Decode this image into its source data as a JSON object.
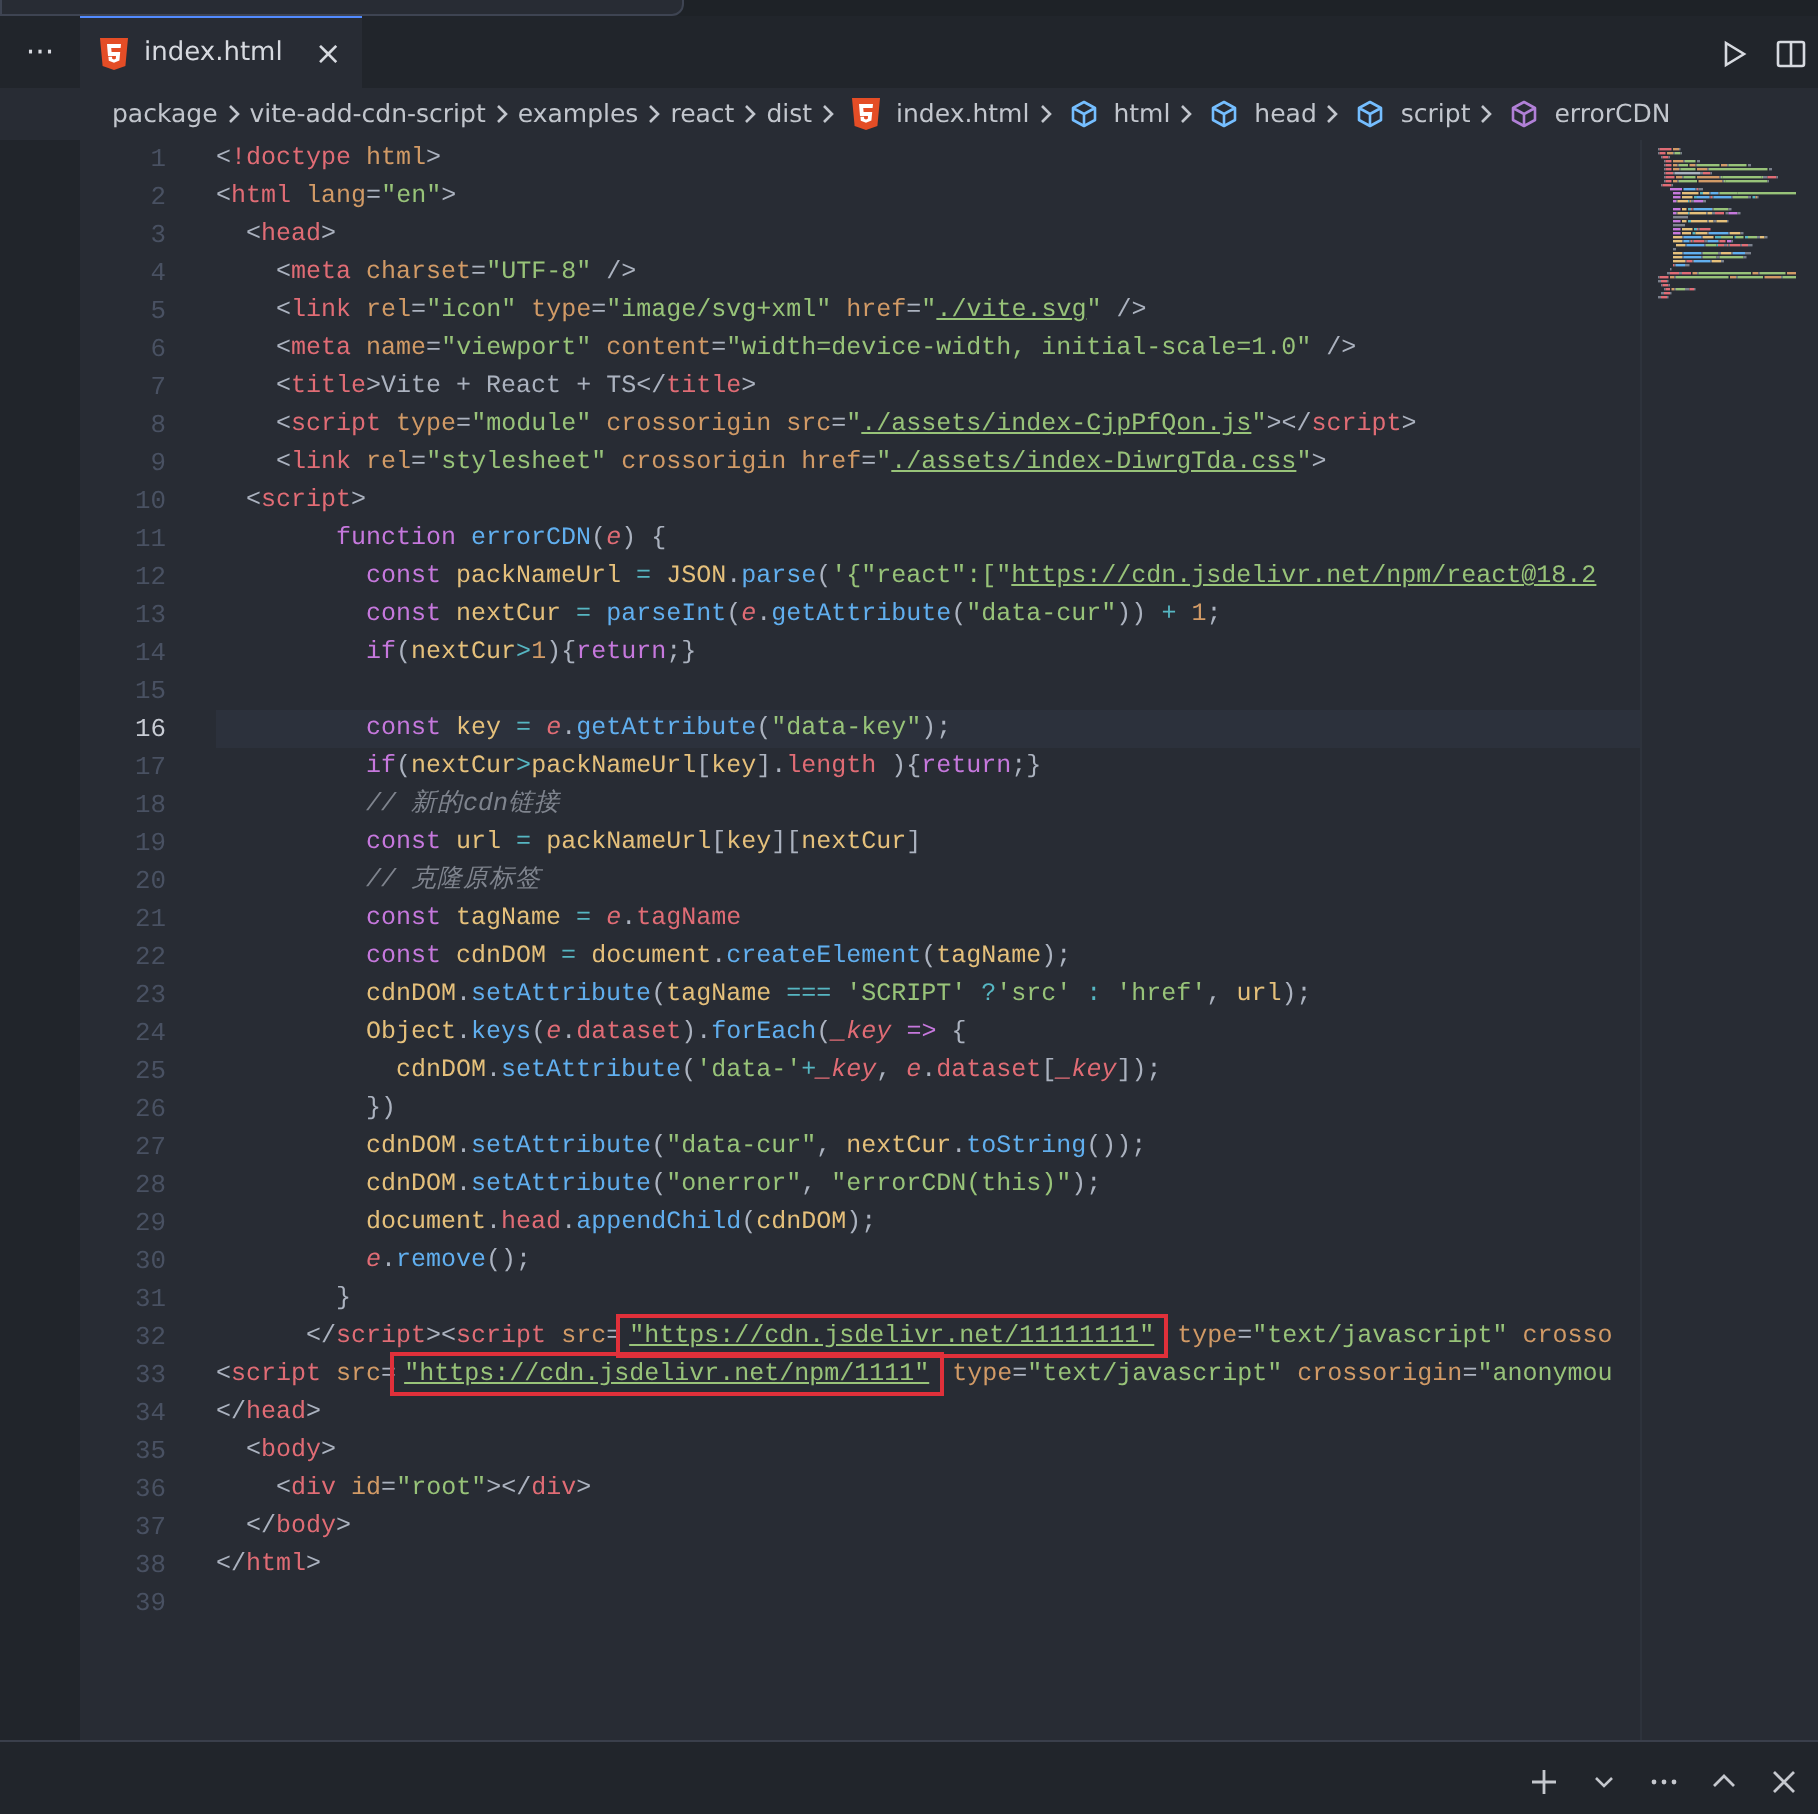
{
  "tab_bar": {
    "overflow": "···",
    "tabs": [
      {
        "label": "index.html",
        "close": "×",
        "selected": true
      }
    ]
  },
  "breadcrumb": [
    {
      "label": "package",
      "kind": "folder"
    },
    {
      "label": "vite-add-cdn-script",
      "kind": "folder"
    },
    {
      "label": "examples",
      "kind": "folder"
    },
    {
      "label": "react",
      "kind": "folder"
    },
    {
      "label": "dist",
      "kind": "folder"
    },
    {
      "label": "index.html",
      "kind": "file"
    },
    {
      "label": "html",
      "kind": "element"
    },
    {
      "label": "head",
      "kind": "element"
    },
    {
      "label": "script",
      "kind": "element"
    },
    {
      "label": "errorCDN",
      "kind": "function"
    }
  ],
  "lines": [
    {
      "number": "1",
      "current": false,
      "tokens": [
        {
          "text": "<",
          "kind": "p"
        },
        {
          "text": "!doctype",
          "kind": "tag"
        },
        {
          "text": " html",
          "kind": "attr"
        },
        {
          "text": ">",
          "kind": "p"
        }
      ]
    },
    {
      "number": "2",
      "current": false,
      "tokens": [
        {
          "text": "<",
          "kind": "p"
        },
        {
          "text": "html",
          "kind": "tag"
        },
        {
          "text": " lang",
          "kind": "attr"
        },
        {
          "text": "=",
          "kind": "p"
        },
        {
          "text": "\"en\"",
          "kind": "str"
        },
        {
          "text": ">",
          "kind": "p"
        }
      ]
    },
    {
      "number": "3",
      "current": false,
      "tokens": [
        {
          "text": "  <",
          "kind": "p"
        },
        {
          "text": "head",
          "kind": "tag"
        },
        {
          "text": ">",
          "kind": "p"
        }
      ]
    },
    {
      "number": "4",
      "current": false,
      "tokens": [
        {
          "text": "    <",
          "kind": "p"
        },
        {
          "text": "meta",
          "kind": "tag"
        },
        {
          "text": " charset",
          "kind": "attr"
        },
        {
          "text": "=",
          "kind": "p"
        },
        {
          "text": "\"UTF-8\"",
          "kind": "str"
        },
        {
          "text": " />",
          "kind": "p"
        }
      ]
    },
    {
      "number": "5",
      "current": false,
      "tokens": [
        {
          "text": "    <",
          "kind": "p"
        },
        {
          "text": "link",
          "kind": "tag"
        },
        {
          "text": " rel",
          "kind": "attr"
        },
        {
          "text": "=",
          "kind": "p"
        },
        {
          "text": "\"icon\"",
          "kind": "str"
        },
        {
          "text": " type",
          "kind": "attr"
        },
        {
          "text": "=",
          "kind": "p"
        },
        {
          "text": "\"image/svg+xml\"",
          "kind": "str"
        },
        {
          "text": " href",
          "kind": "attr"
        },
        {
          "text": "=",
          "kind": "p"
        },
        {
          "text": "\"",
          "kind": "str"
        },
        {
          "text": "./vite.svg",
          "kind": "url"
        },
        {
          "text": "\"",
          "kind": "str"
        },
        {
          "text": " />",
          "kind": "p"
        }
      ]
    },
    {
      "number": "6",
      "current": false,
      "tokens": [
        {
          "text": "    <",
          "kind": "p"
        },
        {
          "text": "meta",
          "kind": "tag"
        },
        {
          "text": " name",
          "kind": "attr"
        },
        {
          "text": "=",
          "kind": "p"
        },
        {
          "text": "\"viewport\"",
          "kind": "str"
        },
        {
          "text": " content",
          "kind": "attr"
        },
        {
          "text": "=",
          "kind": "p"
        },
        {
          "text": "\"width=device-width, initial-scale=1.0\"",
          "kind": "str"
        },
        {
          "text": " />",
          "kind": "p"
        }
      ]
    },
    {
      "number": "7",
      "current": false,
      "tokens": [
        {
          "text": "    <",
          "kind": "p"
        },
        {
          "text": "title",
          "kind": "tag"
        },
        {
          "text": ">",
          "kind": "p"
        },
        {
          "text": "Vite + React + TS",
          "kind": "plain"
        },
        {
          "text": "</",
          "kind": "p"
        },
        {
          "text": "title",
          "kind": "tag"
        },
        {
          "text": ">",
          "kind": "p"
        }
      ]
    },
    {
      "number": "8",
      "current": false,
      "tokens": [
        {
          "text": "    <",
          "kind": "p"
        },
        {
          "text": "script",
          "kind": "tag"
        },
        {
          "text": " type",
          "kind": "attr"
        },
        {
          "text": "=",
          "kind": "p"
        },
        {
          "text": "\"module\"",
          "kind": "str"
        },
        {
          "text": " crossorigin src",
          "kind": "attr"
        },
        {
          "text": "=",
          "kind": "p"
        },
        {
          "text": "\"",
          "kind": "str"
        },
        {
          "text": "./assets/index-CjpPfQon.js",
          "kind": "url"
        },
        {
          "text": "\"",
          "kind": "str"
        },
        {
          "text": "></",
          "kind": "p"
        },
        {
          "text": "script",
          "kind": "tag"
        },
        {
          "text": ">",
          "kind": "p"
        }
      ]
    },
    {
      "number": "9",
      "current": false,
      "tokens": [
        {
          "text": "    <",
          "kind": "p"
        },
        {
          "text": "link",
          "kind": "tag"
        },
        {
          "text": " rel",
          "kind": "attr"
        },
        {
          "text": "=",
          "kind": "p"
        },
        {
          "text": "\"stylesheet\"",
          "kind": "str"
        },
        {
          "text": " crossorigin href",
          "kind": "attr"
        },
        {
          "text": "=",
          "kind": "p"
        },
        {
          "text": "\"",
          "kind": "str"
        },
        {
          "text": "./assets/index-DiwrgTda.css",
          "kind": "url"
        },
        {
          "text": "\"",
          "kind": "str"
        },
        {
          "text": ">",
          "kind": "p"
        }
      ]
    },
    {
      "number": "10",
      "current": false,
      "tokens": [
        {
          "text": "  <",
          "kind": "p"
        },
        {
          "text": "script",
          "kind": "tag"
        },
        {
          "text": ">",
          "kind": "p"
        }
      ]
    },
    {
      "number": "11",
      "current": false,
      "tokens": [
        {
          "text": "        function",
          "kind": "kw"
        },
        {
          "text": " errorCDN",
          "kind": "fn"
        },
        {
          "text": "(",
          "kind": "p"
        },
        {
          "text": "e",
          "kind": "prm"
        },
        {
          "text": ") {",
          "kind": "p"
        }
      ]
    },
    {
      "number": "12",
      "current": false,
      "tokens": [
        {
          "text": "          const",
          "kind": "kw"
        },
        {
          "text": " packNameUrl",
          "kind": "var"
        },
        {
          "text": " = ",
          "kind": "op"
        },
        {
          "text": "JSON",
          "kind": "var"
        },
        {
          "text": ".",
          "kind": "p"
        },
        {
          "text": "parse",
          "kind": "fn"
        },
        {
          "text": "(",
          "kind": "p"
        },
        {
          "text": "'{\"react\":[\"",
          "kind": "str"
        },
        {
          "text": "https://cdn.jsdelivr.net/npm/react@18.2",
          "kind": "url"
        }
      ]
    },
    {
      "number": "13",
      "current": false,
      "tokens": [
        {
          "text": "          const",
          "kind": "kw"
        },
        {
          "text": " nextCur",
          "kind": "var"
        },
        {
          "text": " = ",
          "kind": "op"
        },
        {
          "text": "parseInt",
          "kind": "fn"
        },
        {
          "text": "(",
          "kind": "p"
        },
        {
          "text": "e",
          "kind": "prm"
        },
        {
          "text": ".",
          "kind": "p"
        },
        {
          "text": "getAttribute",
          "kind": "fn"
        },
        {
          "text": "(",
          "kind": "p"
        },
        {
          "text": "\"data-cur\"",
          "kind": "str"
        },
        {
          "text": "))",
          "kind": "p"
        },
        {
          "text": " + ",
          "kind": "op"
        },
        {
          "text": "1",
          "kind": "num"
        },
        {
          "text": ";",
          "kind": "p"
        }
      ]
    },
    {
      "number": "14",
      "current": false,
      "tokens": [
        {
          "text": "          if",
          "kind": "kw"
        },
        {
          "text": "(",
          "kind": "p"
        },
        {
          "text": "nextCur",
          "kind": "var"
        },
        {
          "text": ">",
          "kind": "op"
        },
        {
          "text": "1",
          "kind": "num"
        },
        {
          "text": "){",
          "kind": "p"
        },
        {
          "text": "return",
          "kind": "kw"
        },
        {
          "text": ";}",
          "kind": "p"
        }
      ]
    },
    {
      "number": "15",
      "current": false
    },
    {
      "number": "16",
      "current": true,
      "tokens": [
        {
          "text": "          const",
          "kind": "kw"
        },
        {
          "text": " key",
          "kind": "var"
        },
        {
          "text": " = ",
          "kind": "op"
        },
        {
          "text": "e",
          "kind": "prm"
        },
        {
          "text": ".",
          "kind": "p"
        },
        {
          "text": "getAttribute",
          "kind": "fn"
        },
        {
          "text": "(",
          "kind": "p"
        },
        {
          "text": "\"data-key\"",
          "kind": "str"
        },
        {
          "text": ");",
          "kind": "p"
        }
      ]
    },
    {
      "number": "17",
      "current": false,
      "tokens": [
        {
          "text": "          if",
          "kind": "kw"
        },
        {
          "text": "(",
          "kind": "p"
        },
        {
          "text": "nextCur",
          "kind": "var"
        },
        {
          "text": ">",
          "kind": "op"
        },
        {
          "text": "packNameUrl",
          "kind": "var"
        },
        {
          "text": "[",
          "kind": "p"
        },
        {
          "text": "key",
          "kind": "var"
        },
        {
          "text": "].",
          "kind": "p"
        },
        {
          "text": "length",
          "kind": "prop"
        },
        {
          "text": " ){",
          "kind": "p"
        },
        {
          "text": "return",
          "kind": "kw"
        },
        {
          "text": ";}",
          "kind": "p"
        }
      ]
    },
    {
      "number": "18",
      "current": false,
      "tokens": [
        {
          "text": "          // 新的cdn链接",
          "kind": "cmt"
        }
      ]
    },
    {
      "number": "19",
      "current": false,
      "tokens": [
        {
          "text": "          const",
          "kind": "kw"
        },
        {
          "text": " url",
          "kind": "var"
        },
        {
          "text": " = ",
          "kind": "op"
        },
        {
          "text": "packNameUrl",
          "kind": "var"
        },
        {
          "text": "[",
          "kind": "p"
        },
        {
          "text": "key",
          "kind": "var"
        },
        {
          "text": "][",
          "kind": "p"
        },
        {
          "text": "nextCur",
          "kind": "var"
        },
        {
          "text": "]",
          "kind": "p"
        }
      ]
    },
    {
      "number": "20",
      "current": false,
      "tokens": [
        {
          "text": "          // 克隆原标签",
          "kind": "cmt"
        }
      ]
    },
    {
      "number": "21",
      "current": false,
      "tokens": [
        {
          "text": "          const",
          "kind": "kw"
        },
        {
          "text": " tagName",
          "kind": "var"
        },
        {
          "text": " = ",
          "kind": "op"
        },
        {
          "text": "e",
          "kind": "prm"
        },
        {
          "text": ".",
          "kind": "p"
        },
        {
          "text": "tagName",
          "kind": "prop"
        }
      ]
    },
    {
      "number": "22",
      "current": false,
      "tokens": [
        {
          "text": "          const",
          "kind": "kw"
        },
        {
          "text": " cdnDOM",
          "kind": "var"
        },
        {
          "text": " = ",
          "kind": "op"
        },
        {
          "text": "document",
          "kind": "var"
        },
        {
          "text": ".",
          "kind": "p"
        },
        {
          "text": "createElement",
          "kind": "fn"
        },
        {
          "text": "(",
          "kind": "p"
        },
        {
          "text": "tagName",
          "kind": "var"
        },
        {
          "text": ");",
          "kind": "p"
        }
      ]
    },
    {
      "number": "23",
      "current": false,
      "tokens": [
        {
          "text": "          cdnDOM",
          "kind": "var"
        },
        {
          "text": ".",
          "kind": "p"
        },
        {
          "text": "setAttribute",
          "kind": "fn"
        },
        {
          "text": "(",
          "kind": "p"
        },
        {
          "text": "tagName",
          "kind": "var"
        },
        {
          "text": " === ",
          "kind": "op"
        },
        {
          "text": "'SCRIPT'",
          "kind": "str"
        },
        {
          "text": " ?",
          "kind": "op"
        },
        {
          "text": "'src'",
          "kind": "str"
        },
        {
          "text": " : ",
          "kind": "op"
        },
        {
          "text": "'href'",
          "kind": "str"
        },
        {
          "text": ", ",
          "kind": "p"
        },
        {
          "text": "url",
          "kind": "var"
        },
        {
          "text": ");",
          "kind": "p"
        }
      ]
    },
    {
      "number": "24",
      "current": false,
      "tokens": [
        {
          "text": "          Object",
          "kind": "var"
        },
        {
          "text": ".",
          "kind": "p"
        },
        {
          "text": "keys",
          "kind": "fn"
        },
        {
          "text": "(",
          "kind": "p"
        },
        {
          "text": "e",
          "kind": "prm"
        },
        {
          "text": ".",
          "kind": "p"
        },
        {
          "text": "dataset",
          "kind": "prop"
        },
        {
          "text": ").",
          "kind": "p"
        },
        {
          "text": "forEach",
          "kind": "fn"
        },
        {
          "text": "(",
          "kind": "p"
        },
        {
          "text": "_key",
          "kind": "prm"
        },
        {
          "text": " => ",
          "kind": "kw"
        },
        {
          "text": "{",
          "kind": "p"
        }
      ]
    },
    {
      "number": "25",
      "current": false,
      "tokens": [
        {
          "text": "            cdnDOM",
          "kind": "var"
        },
        {
          "text": ".",
          "kind": "p"
        },
        {
          "text": "setAttribute",
          "kind": "fn"
        },
        {
          "text": "(",
          "kind": "p"
        },
        {
          "text": "'data-'",
          "kind": "str"
        },
        {
          "text": "+",
          "kind": "op"
        },
        {
          "text": "_key",
          "kind": "prm"
        },
        {
          "text": ", ",
          "kind": "p"
        },
        {
          "text": "e",
          "kind": "prm"
        },
        {
          "text": ".",
          "kind": "p"
        },
        {
          "text": "dataset",
          "kind": "prop"
        },
        {
          "text": "[",
          "kind": "p"
        },
        {
          "text": "_key",
          "kind": "prm"
        },
        {
          "text": "]);",
          "kind": "p"
        }
      ]
    },
    {
      "number": "26",
      "current": false,
      "tokens": [
        {
          "text": "          })",
          "kind": "p"
        }
      ]
    },
    {
      "number": "27",
      "current": false,
      "tokens": [
        {
          "text": "          cdnDOM",
          "kind": "var"
        },
        {
          "text": ".",
          "kind": "p"
        },
        {
          "text": "setAttribute",
          "kind": "fn"
        },
        {
          "text": "(",
          "kind": "p"
        },
        {
          "text": "\"data-cur\"",
          "kind": "str"
        },
        {
          "text": ", ",
          "kind": "p"
        },
        {
          "text": "nextCur",
          "kind": "var"
        },
        {
          "text": ".",
          "kind": "p"
        },
        {
          "text": "toString",
          "kind": "fn"
        },
        {
          "text": "());",
          "kind": "p"
        }
      ]
    },
    {
      "number": "28",
      "current": false,
      "tokens": [
        {
          "text": "          cdnDOM",
          "kind": "var"
        },
        {
          "text": ".",
          "kind": "p"
        },
        {
          "text": "setAttribute",
          "kind": "fn"
        },
        {
          "text": "(",
          "kind": "p"
        },
        {
          "text": "\"onerror\"",
          "kind": "str"
        },
        {
          "text": ", ",
          "kind": "p"
        },
        {
          "text": "\"errorCDN(this)\"",
          "kind": "str"
        },
        {
          "text": ");",
          "kind": "p"
        }
      ]
    },
    {
      "number": "29",
      "current": false,
      "tokens": [
        {
          "text": "          document",
          "kind": "var"
        },
        {
          "text": ".",
          "kind": "p"
        },
        {
          "text": "head",
          "kind": "prop"
        },
        {
          "text": ".",
          "kind": "p"
        },
        {
          "text": "appendChild",
          "kind": "fn"
        },
        {
          "text": "(",
          "kind": "p"
        },
        {
          "text": "cdnDOM",
          "kind": "var"
        },
        {
          "text": ");",
          "kind": "p"
        }
      ]
    },
    {
      "number": "30",
      "current": false,
      "tokens": [
        {
          "text": "          e",
          "kind": "prm"
        },
        {
          "text": ".",
          "kind": "p"
        },
        {
          "text": "remove",
          "kind": "fn"
        },
        {
          "text": "();",
          "kind": "p"
        }
      ]
    },
    {
      "number": "31",
      "current": false,
      "tokens": [
        {
          "text": "        }",
          "kind": "p"
        }
      ]
    },
    {
      "number": "32",
      "current": false,
      "tokens": [
        {
          "text": "      </",
          "kind": "p"
        },
        {
          "text": "script",
          "kind": "tag"
        },
        {
          "text": "><",
          "kind": "p"
        },
        {
          "text": "script",
          "kind": "tag"
        },
        {
          "text": " src",
          "kind": "attr"
        },
        {
          "text": "=",
          "kind": "p"
        },
        {
          "text": "\"https://cdn.jsdelivr.net/11111111\"",
          "kind": "boxed"
        },
        {
          "text": " type",
          "kind": "attr"
        },
        {
          "text": "=",
          "kind": "p"
        },
        {
          "text": "\"text/javascript\"",
          "kind": "str"
        },
        {
          "text": " crosso",
          "kind": "attr"
        }
      ]
    },
    {
      "number": "33",
      "current": false,
      "tokens": [
        {
          "text": "<",
          "kind": "p"
        },
        {
          "text": "script",
          "kind": "tag"
        },
        {
          "text": " src",
          "kind": "attr"
        },
        {
          "text": "=",
          "kind": "p"
        },
        {
          "text": "\"https://cdn.jsdelivr.net/npm/1111\"",
          "kind": "boxed"
        },
        {
          "text": " type",
          "kind": "attr"
        },
        {
          "text": "=",
          "kind": "p"
        },
        {
          "text": "\"text/javascript\"",
          "kind": "str"
        },
        {
          "text": " crossorigin",
          "kind": "attr"
        },
        {
          "text": "=",
          "kind": "p"
        },
        {
          "text": "\"anonymou",
          "kind": "str"
        }
      ]
    },
    {
      "number": "34",
      "current": false,
      "tokens": [
        {
          "text": "</",
          "kind": "p"
        },
        {
          "text": "head",
          "kind": "tag"
        },
        {
          "text": ">",
          "kind": "p"
        }
      ]
    },
    {
      "number": "35",
      "current": false,
      "tokens": [
        {
          "text": "  <",
          "kind": "p"
        },
        {
          "text": "body",
          "kind": "tag"
        },
        {
          "text": ">",
          "kind": "p"
        }
      ]
    },
    {
      "number": "36",
      "current": false,
      "tokens": [
        {
          "text": "    <",
          "kind": "p"
        },
        {
          "text": "div",
          "kind": "tag"
        },
        {
          "text": " id",
          "kind": "attr"
        },
        {
          "text": "=",
          "kind": "p"
        },
        {
          "text": "\"root\"",
          "kind": "str"
        },
        {
          "text": "></",
          "kind": "p"
        },
        {
          "text": "div",
          "kind": "tag"
        },
        {
          "text": ">",
          "kind": "p"
        }
      ]
    },
    {
      "number": "37",
      "current": false,
      "tokens": [
        {
          "text": "  </",
          "kind": "p"
        },
        {
          "text": "body",
          "kind": "tag"
        },
        {
          "text": ">",
          "kind": "p"
        }
      ]
    },
    {
      "number": "38",
      "current": false,
      "tokens": [
        {
          "text": "</",
          "kind": "p"
        },
        {
          "text": "html",
          "kind": "tag"
        },
        {
          "text": ">",
          "kind": "p"
        }
      ]
    },
    {
      "number": "39",
      "current": false
    }
  ]
}
